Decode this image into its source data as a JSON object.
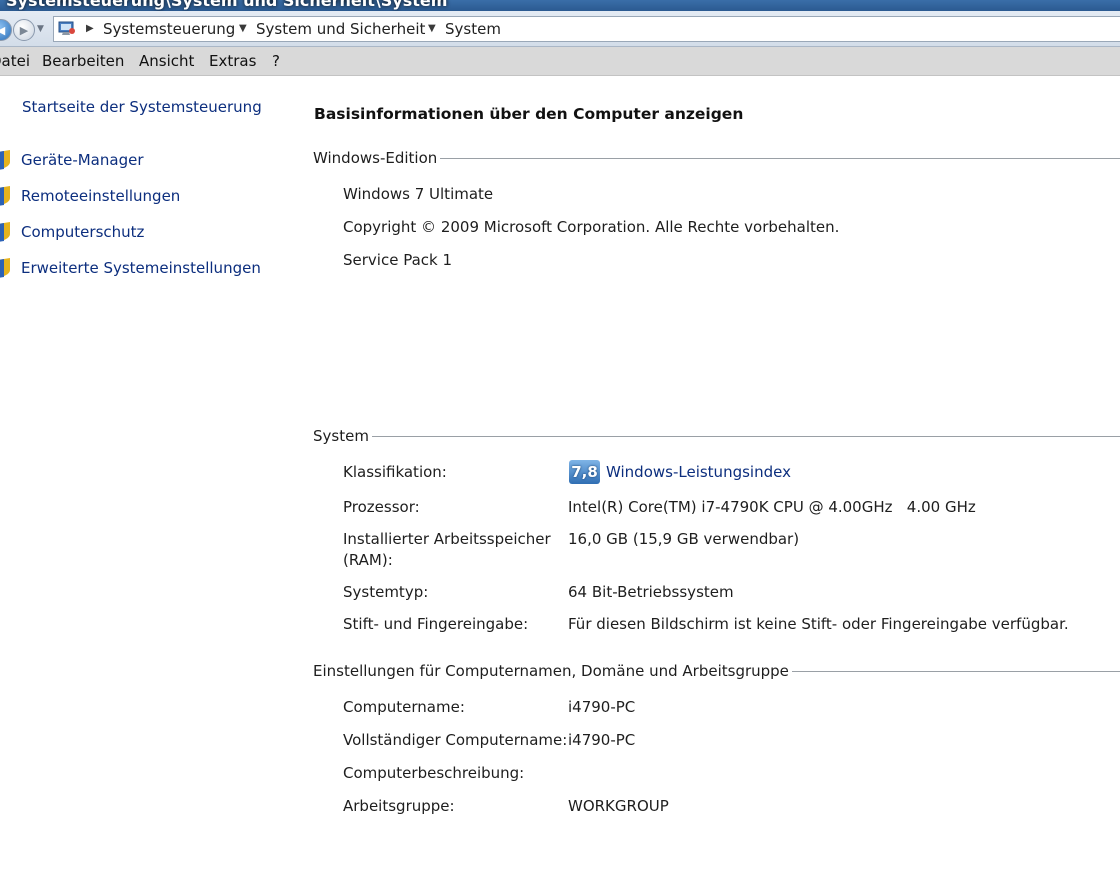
{
  "window": {
    "title": "Systemsteuerung\\System und Sicherheit\\System"
  },
  "address": {
    "crumbs": [
      "Systemsteuerung",
      "System und Sicherheit",
      "System"
    ]
  },
  "menu": {
    "items": [
      "Datei",
      "Bearbeiten",
      "Ansicht",
      "Extras",
      "?"
    ]
  },
  "sidebar": {
    "home_link": "Startseite der Systemsteuerung",
    "links": [
      "Geräte-Manager",
      "Remoteeinstellungen",
      "Computerschutz",
      "Erweiterte Systemeinstellungen"
    ]
  },
  "main": {
    "heading": "Basisinformationen über den Computer anzeigen",
    "edition": {
      "title": "Windows-Edition",
      "name": "Windows 7 Ultimate",
      "copyright": "Copyright © 2009 Microsoft Corporation. Alle Rechte vorbehalten.",
      "service_pack": "Service Pack 1"
    },
    "system": {
      "title": "System",
      "rating_label": "Klassifikation:",
      "rating_score": "7,8",
      "rating_link": "Windows-Leistungsindex",
      "processor_label": "Prozessor:",
      "processor_value": "Intel(R) Core(TM) i7-4790K CPU @ 4.00GHz   4.00 GHz",
      "ram_label_line1": "Installierter Arbeitsspeicher",
      "ram_label_line2": "(RAM):",
      "ram_value": "16,0 GB (15,9 GB verwendbar)",
      "systype_label": "Systemtyp:",
      "systype_value": "64 Bit-Betriebssystem",
      "pen_label": "Stift- und Fingereingabe:",
      "pen_value": "Für diesen Bildschirm ist keine Stift- oder Fingereingabe verfügbar."
    },
    "computer": {
      "title": "Einstellungen für Computernamen, Domäne und Arbeitsgruppe",
      "name_label": "Computername:",
      "name_value": "i4790-PC",
      "fullname_label": "Vollständiger Computername:",
      "fullname_value": "i4790-PC",
      "desc_label": "Computerbeschreibung:",
      "desc_value": "",
      "workgroup_label": "Arbeitsgruppe:",
      "workgroup_value": "WORKGROUP"
    }
  },
  "colors": {
    "link": "#0c2e7e",
    "titlebar": "#2b5a91",
    "menubar": "#d9d9d9",
    "badge": "#2f6eb3"
  }
}
